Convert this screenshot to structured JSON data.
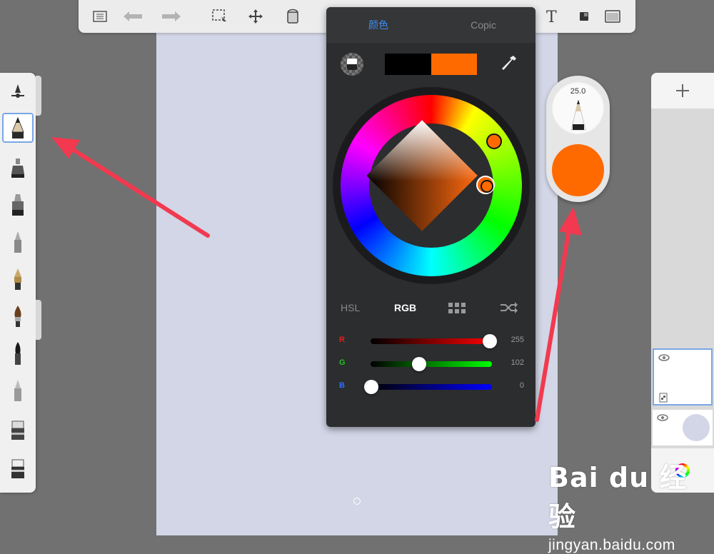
{
  "color_panel": {
    "tabs": [
      "颜色",
      "Copic"
    ],
    "active_tab_color": "#3b8df0",
    "secondary_swatch": "#000000",
    "primary_swatch": "#ff6a00",
    "modes": [
      "HSL",
      "RGB"
    ],
    "active_mode": "RGB",
    "sliders": [
      {
        "label": "R",
        "value": "255",
        "fraction": 1.0,
        "label_color": "#e02020",
        "gradient": [
          "#000000",
          "#ff0000"
        ]
      },
      {
        "label": "G",
        "value": "102",
        "fraction": 0.4,
        "label_color": "#20c020",
        "gradient": [
          "#000000",
          "#00ff00"
        ]
      },
      {
        "label": "B",
        "value": "0",
        "fraction": 0.0,
        "label_color": "#3070ff",
        "gradient": [
          "#000000",
          "#0000ff"
        ]
      }
    ]
  },
  "brush_puck": {
    "size": "25.0",
    "color": "#ff6a00"
  },
  "watermark": {
    "logo": "Bai du 经验",
    "url": "jingyan.baidu.com"
  },
  "icons": {
    "toolbar": [
      "list-icon",
      "undo-icon",
      "redo-icon",
      "selection-icon",
      "move-icon",
      "fill-bucket-icon",
      "text-icon",
      "layer-icon",
      "fullscreen-icon"
    ],
    "brushes": [
      "brush-settings-icon",
      "pencil-brush-icon",
      "airbrush-icon",
      "marker-icon",
      "ballpoint-icon",
      "fountain-pen-icon",
      "paintbrush-icon",
      "ink-brush-icon",
      "smudge-icon",
      "eraser-icon",
      "hard-eraser-icon"
    ]
  }
}
